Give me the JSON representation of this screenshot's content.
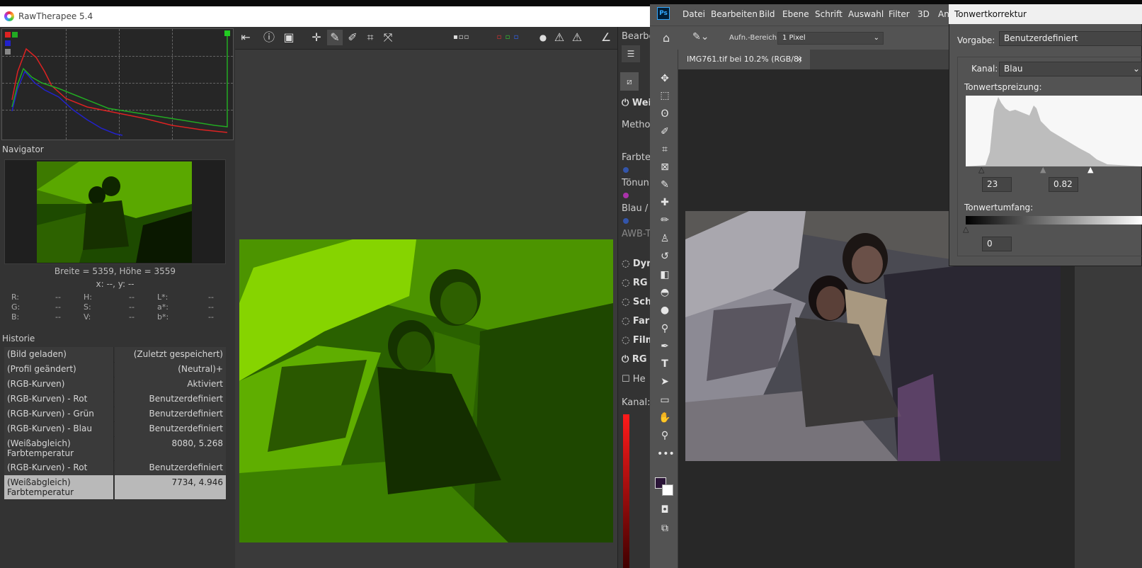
{
  "rawtherapee": {
    "title": "RawTherapee 5.4",
    "navigator_title": "Navigator",
    "dimensions": "Breite = 5359, Höhe = 3559",
    "coords": "x: --, y: --",
    "values": [
      {
        "k": "R:",
        "v": "--"
      },
      {
        "k": "G:",
        "v": "--"
      },
      {
        "k": "B:",
        "v": "--"
      },
      {
        "k": "H:",
        "v": "--"
      },
      {
        "k": "S:",
        "v": "--"
      },
      {
        "k": "V:",
        "v": "--"
      },
      {
        "k": "L*:",
        "v": "--"
      },
      {
        "k": "a*:",
        "v": "--"
      },
      {
        "k": "b*:",
        "v": "--"
      }
    ],
    "history_title": "Historie",
    "history": [
      {
        "action": "(Bild geladen)",
        "value": "(Zuletzt gespeichert)"
      },
      {
        "action": "(Profil geändert)",
        "value": "(Neutral)+"
      },
      {
        "action": "(RGB-Kurven)",
        "value": "Aktiviert"
      },
      {
        "action": "(RGB-Kurven) - Rot",
        "value": "Benutzerdefiniert"
      },
      {
        "action": "(RGB-Kurven) - Grün",
        "value": "Benutzerdefiniert"
      },
      {
        "action": "(RGB-Kurven) - Blau",
        "value": "Benutzerdefiniert"
      },
      {
        "action": "(Weißabgleich) Farbtemperatur",
        "value": "8080, 5.268"
      },
      {
        "action": "(RGB-Kurven) - Rot",
        "value": "Benutzerdefiniert"
      },
      {
        "action": "(Weißabgleich) Farbtemperatur",
        "value": "7734, 4.946"
      }
    ],
    "right_panel": {
      "header": "Bearbe",
      "items": [
        "Wei",
        "Metho",
        "Farbte",
        "Tönun",
        "Blau /",
        "AWB-T",
        "Dyn",
        "RG",
        "Sch",
        "Far",
        "Film",
        "RG",
        "He",
        "Kanal:"
      ]
    }
  },
  "photoshop": {
    "menu": [
      "Datei",
      "Bearbeiten",
      "Bild",
      "Ebene",
      "Schrift",
      "Auswahl",
      "Filter",
      "3D",
      "An"
    ],
    "logo": "Ps",
    "options_label": "Aufn.-Bereich:",
    "options_value": "1 Pixel",
    "doc_tab": "IMG761.tif bei 10.2% (RGB/8)",
    "doc_tab_close": "×"
  },
  "levels_dialog": {
    "title": "Tonwertkorrektur",
    "preset_label": "Vorgabe:",
    "preset_value": "Benutzerdefiniert",
    "channel_label": "Kanal:",
    "channel_value": "Blau",
    "input_levels_label": "Tonwertspreizung:",
    "input_black": "23",
    "input_gamma": "0.82",
    "output_levels_label": "Tonwertumfang:",
    "output_black": "0"
  }
}
